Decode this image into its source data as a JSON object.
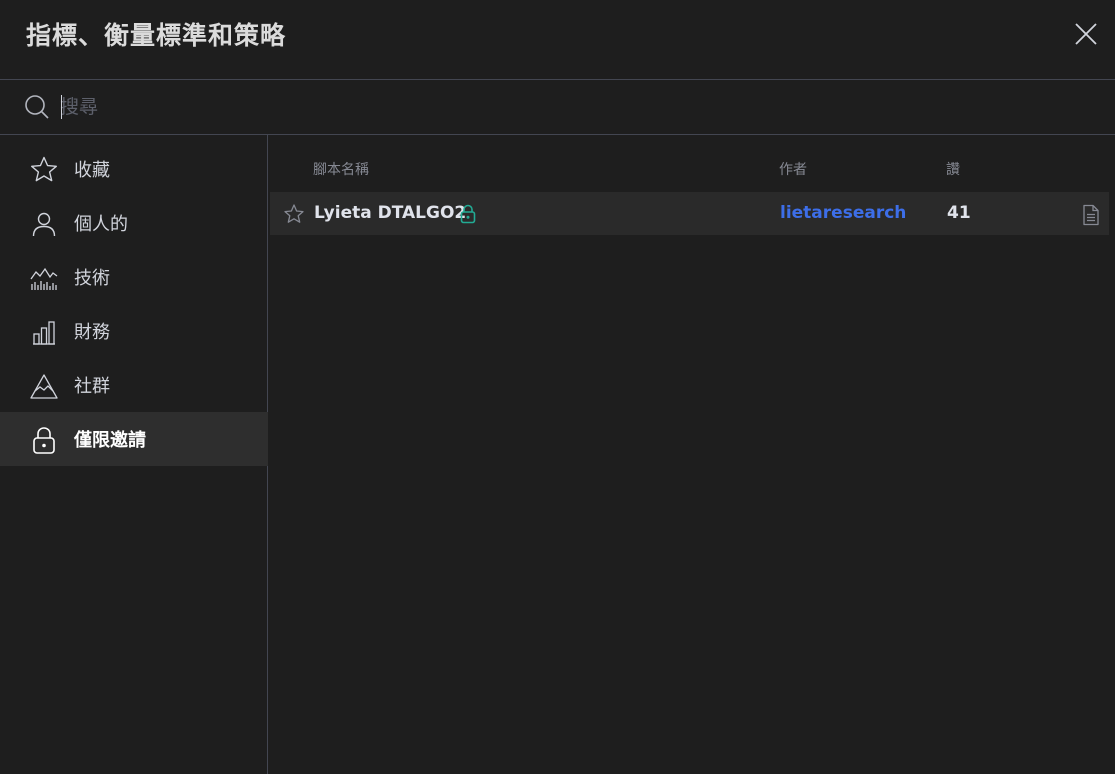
{
  "dialog": {
    "title": "指標、衡量標準和策略",
    "close_icon": "close-icon"
  },
  "search": {
    "placeholder": "搜尋",
    "value": "",
    "icon": "search-icon"
  },
  "sidebar": {
    "items": [
      {
        "label": "收藏",
        "icon": "star-icon",
        "active": false
      },
      {
        "label": "個人的",
        "icon": "user-icon",
        "active": false
      },
      {
        "label": "技術",
        "icon": "chart-waves-icon",
        "active": false
      },
      {
        "label": "財務",
        "icon": "bar-chart-icon",
        "active": false
      },
      {
        "label": "社群",
        "icon": "mountain-icon",
        "active": false
      },
      {
        "label": "僅限邀請",
        "icon": "lock-icon",
        "active": true
      }
    ]
  },
  "table": {
    "columns": [
      "腳本名稱",
      "作者",
      "讚"
    ],
    "rows": [
      {
        "name": "Lyieta DTALGO2",
        "author": "lietaresearch",
        "likes": "41",
        "locked": true
      }
    ]
  },
  "colors": {
    "background": "#1e1e1e",
    "active_bg": "#2e2e2e",
    "row_bg": "#2a2a2a",
    "divider": "#434651",
    "link": "#3d6ee8",
    "lock_green": "#22ab94",
    "text": "#d1d4dc",
    "muted": "#868993"
  }
}
